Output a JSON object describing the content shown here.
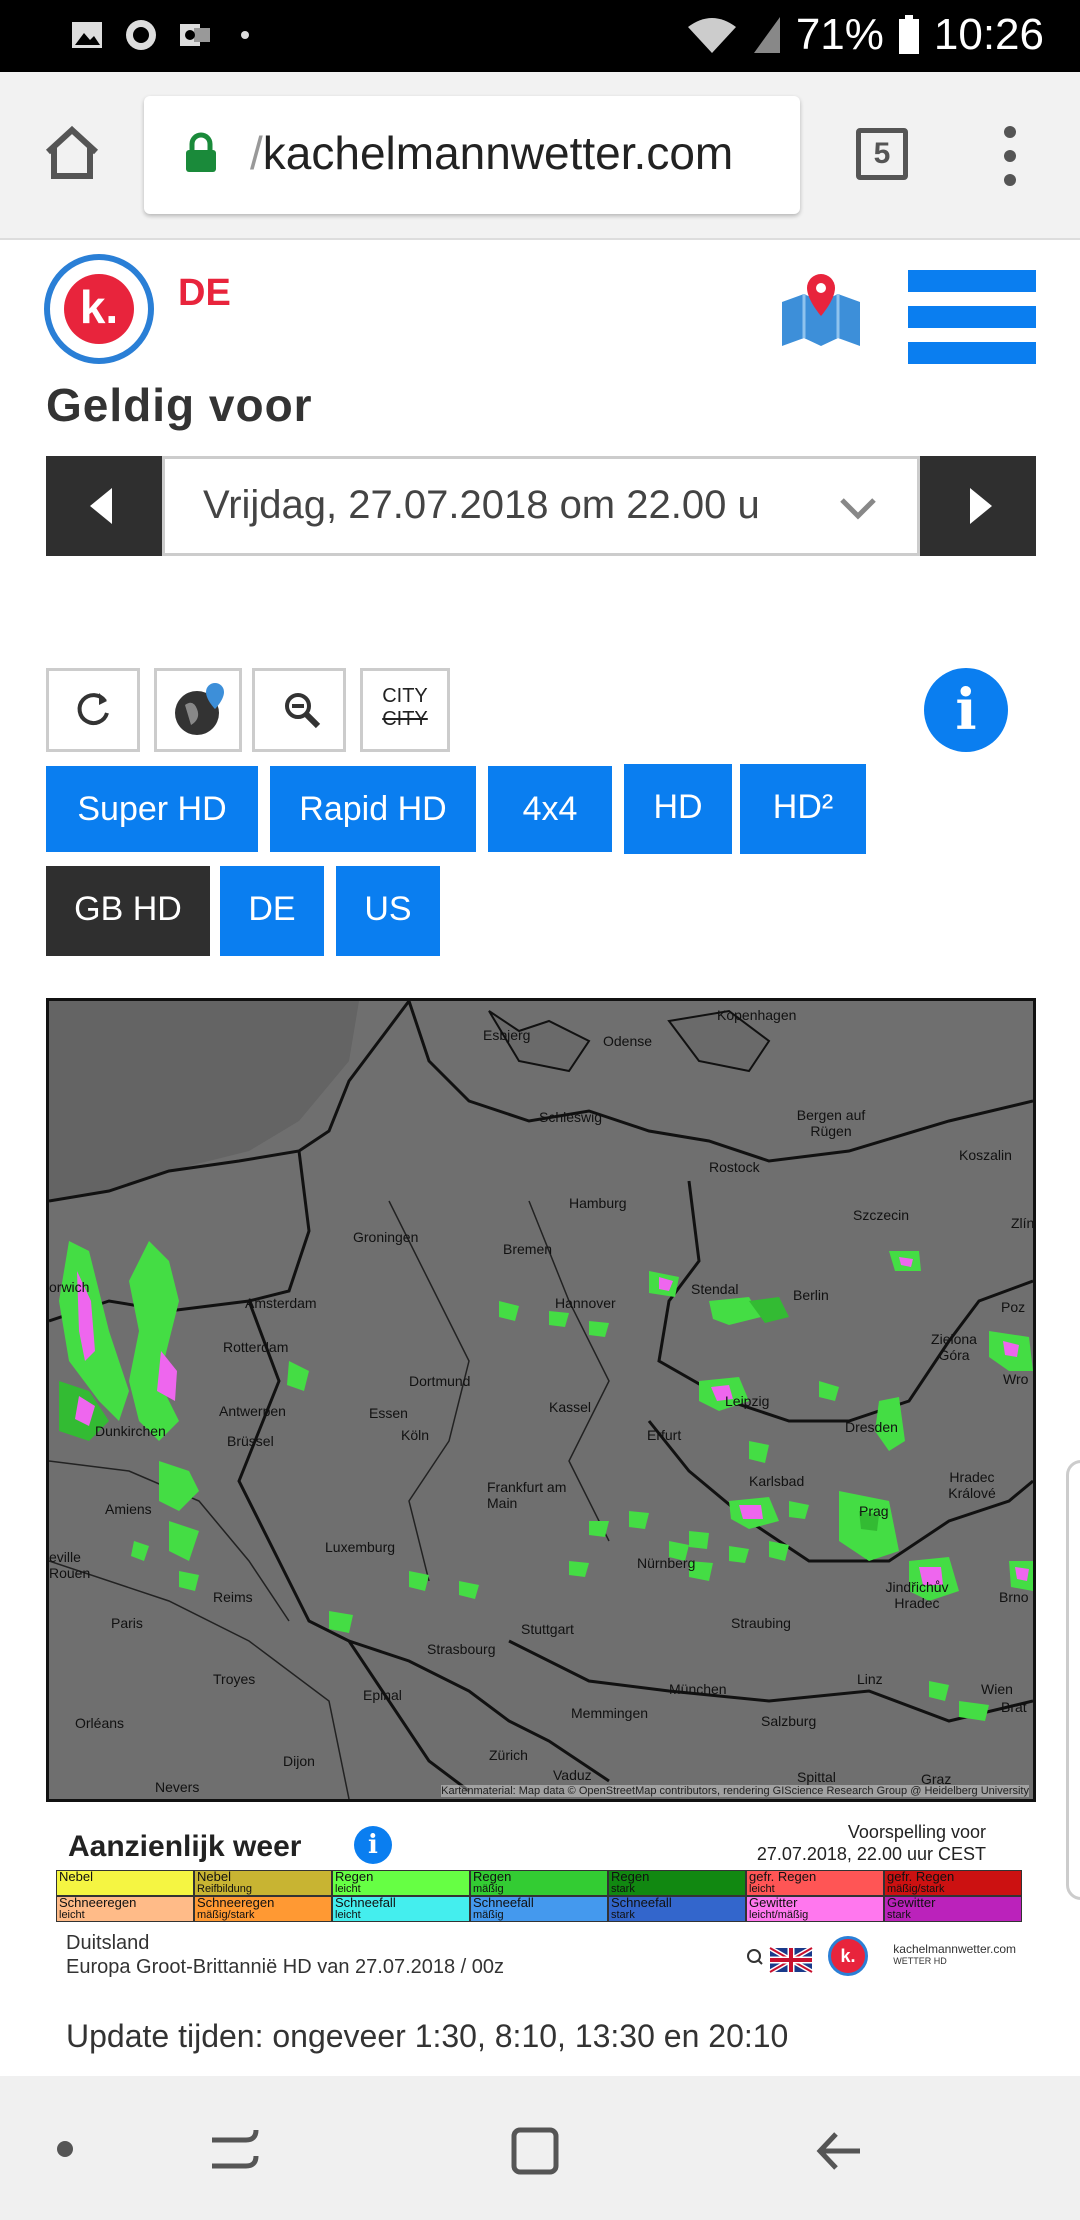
{
  "status_bar": {
    "battery": "71%",
    "time": "10:26"
  },
  "browser": {
    "url_prefix": "/",
    "url_domain": "kachelmannwetter.com",
    "tab_count": "5"
  },
  "header": {
    "logo_text": "k.",
    "region": "DE"
  },
  "valid_for": {
    "label": "Geldig voor",
    "date_value": "Vrijdag, 27.07.2018 om 22.00 u"
  },
  "toolbar": {
    "city_label": "CITY"
  },
  "model_buttons": [
    "Super HD",
    "Rapid HD",
    "4x4",
    "HD",
    "HD²",
    "GB HD",
    "DE",
    "US"
  ],
  "map": {
    "cities": [
      "Kopenhagen",
      "Esbjerg",
      "Odense",
      "Schleswig",
      "Bergen auf Rügen",
      "Rostock",
      "Koszalin",
      "Hamburg",
      "Szczecin",
      "Groningen",
      "Bremen",
      "orwich",
      "Amsterdam",
      "Hannover",
      "Stendal",
      "Berlin",
      "Zielona Góra",
      "Rotterdam",
      "Dortmund",
      "Antwerpen",
      "Essen",
      "Kassel",
      "Leipzig",
      "Dunkirchen",
      "Brüssel",
      "Köln",
      "Erfurt",
      "Dresden",
      "Frankfurt am Main",
      "Karlsbad",
      "Hradec Králové",
      "Amiens",
      "Prag",
      "Luxemburg",
      "Reims",
      "Nürnberg",
      "Jindřichův Hradec",
      "Brno",
      "Paris",
      "Stuttgart",
      "Straubing",
      "Troyes",
      "Strasbourg",
      "Linz",
      "Wien",
      "Epinal",
      "Memmingen",
      "München",
      "Salzburg",
      "Orléans",
      "Dijon",
      "Zürich",
      "Vaduz",
      "Nevers",
      "Spittal",
      "Graz",
      "Poz",
      "Wro",
      "Brat",
      "Zlín",
      "eville Rouen"
    ],
    "credit": "Kartenmaterial: Map data © OpenStreetMap contributors, rendering GIScience Research Group @ Heidelberg University"
  },
  "legend": {
    "title": "Aanzienlijk weer",
    "forecast_line1": "Voorspelling voor",
    "forecast_line2": "27.07.2018, 22.00 uur CEST",
    "row1": [
      {
        "label": "Nebel",
        "sub": "",
        "color": "#f5f542"
      },
      {
        "label": "Nebel",
        "sub": "Reifbildung",
        "color": "#c8b432"
      },
      {
        "label": "Regen",
        "sub": "leicht",
        "color": "#66ff44"
      },
      {
        "label": "Regen",
        "sub": "mäßig",
        "color": "#33cc33"
      },
      {
        "label": "Regen",
        "sub": "stark",
        "color": "#118811"
      },
      {
        "label": "gefr. Regen",
        "sub": "leicht",
        "color": "#ff5555"
      },
      {
        "label": "gefr. Regen",
        "sub": "mäßig/stark",
        "color": "#cc1111"
      }
    ],
    "row2": [
      {
        "label": "Schneeregen",
        "sub": "leicht",
        "color": "#ffbb88"
      },
      {
        "label": "Schneeregen",
        "sub": "mäßig/stark",
        "color": "#ff9933"
      },
      {
        "label": "Schneefall",
        "sub": "leicht",
        "color": "#44eeee"
      },
      {
        "label": "Schneefall",
        "sub": "mäßig",
        "color": "#4499ee"
      },
      {
        "label": "Schneefall",
        "sub": "stark",
        "color": "#3366cc"
      },
      {
        "label": "Gewitter",
        "sub": "leicht/mäßig",
        "color": "#ff77ee"
      },
      {
        "label": "Gewitter",
        "sub": "stark",
        "color": "#bb22bb"
      }
    ],
    "footer_line1": "Duitsland",
    "footer_line2": "Europa Groot-Brittannië HD van 27.07.2018 / 00z",
    "brand": "kachelmannwetter.com",
    "brand_sub": "WETTER HD"
  },
  "update_text": "Update tijden: ongeveer 1:30, 8:10, 13:30 en 20:10",
  "colors": {
    "accent": "#0a7ef0",
    "brand_red": "#e8243c",
    "dark": "#2f2f2f"
  }
}
